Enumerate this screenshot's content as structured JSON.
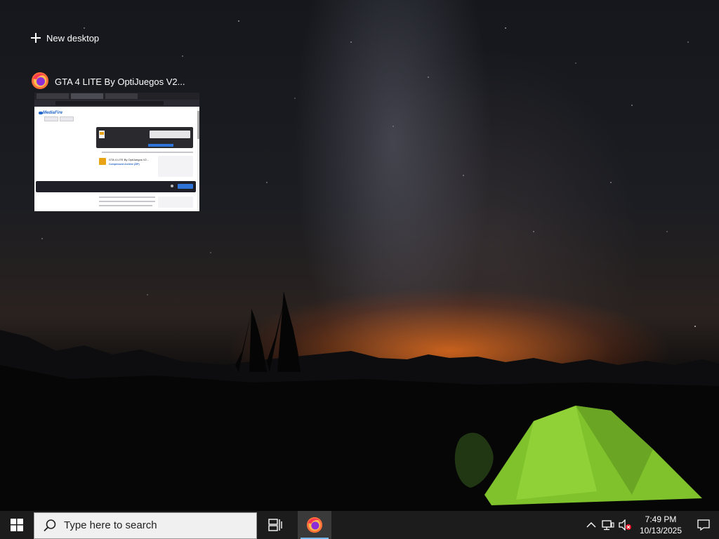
{
  "desktop": {
    "new_desktop_label": "New desktop"
  },
  "task_view": {
    "windows": [
      {
        "title": "GTA 4 LITE By OptiJuegos V2...",
        "app_icon": "firefox-icon",
        "thumbnail": {
          "site_logo": "MediaFire",
          "file_title": "GTA 4 LITE By OptiJuegos V2...",
          "file_type": "Compressed Archive (ZIP)"
        }
      }
    ]
  },
  "taskbar": {
    "start_icon": "windows-logo-icon",
    "search_placeholder": "Type here to search",
    "task_view_icon": "task-view-icon",
    "pinned": [
      {
        "name": "Firefox",
        "icon": "firefox-icon",
        "active": true
      }
    ],
    "tray": {
      "show_hidden_icon": "chevron-up-icon",
      "network_icon": "network-icon",
      "volume_icon": "volume-muted-icon",
      "time": "7:49 PM",
      "date": "10/13/2025",
      "notification_icon": "notification-icon"
    }
  },
  "colors": {
    "taskbar_bg": "#1c1c1c",
    "active_indicator": "#76b9ed",
    "search_bg": "#f0f0f0"
  }
}
